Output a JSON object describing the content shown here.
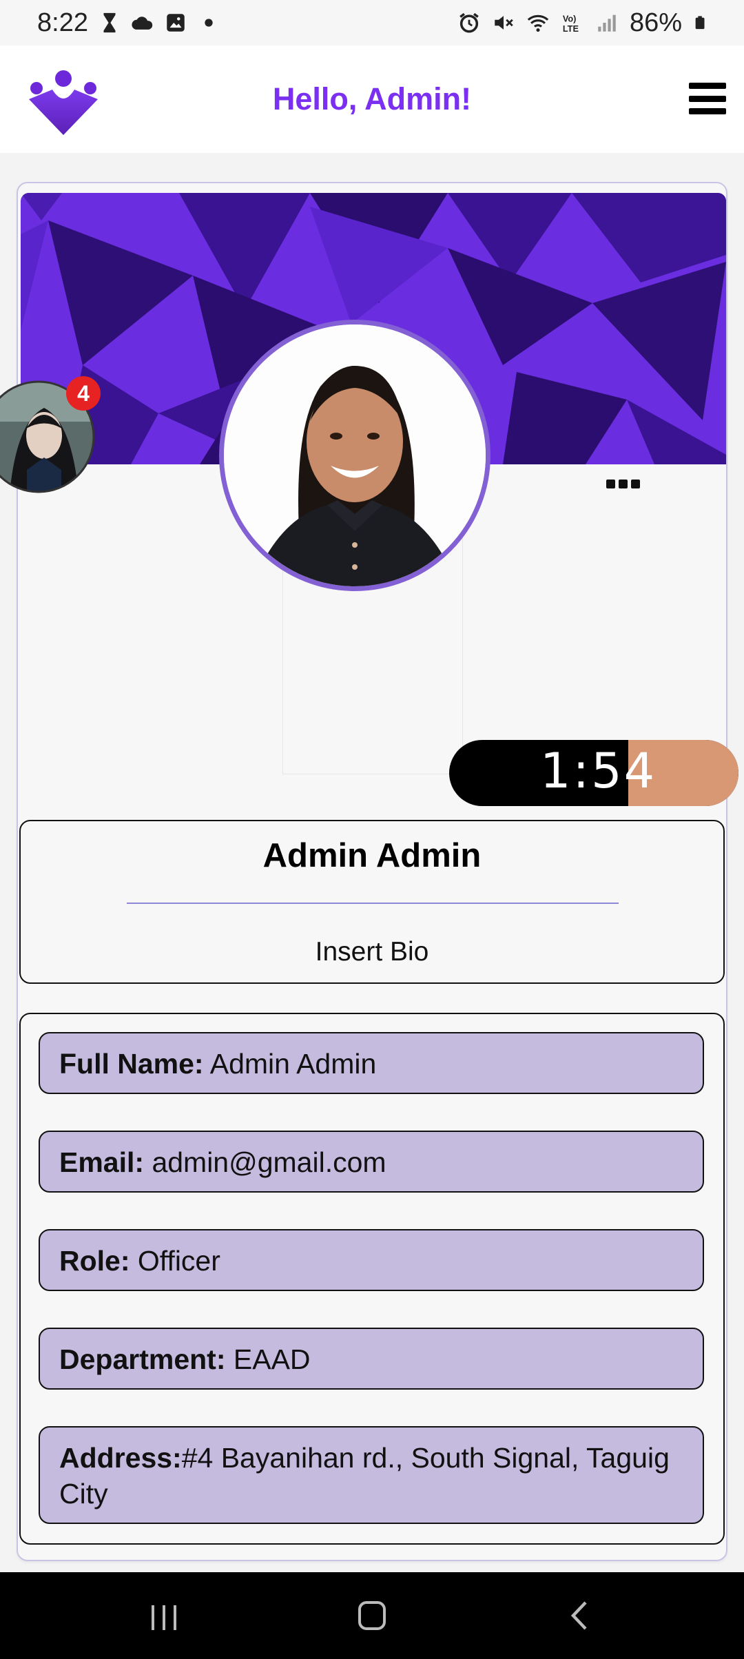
{
  "status_bar": {
    "time": "8:22",
    "battery": "86%",
    "left_icons": [
      "hourglass-icon",
      "cloud-icon",
      "image-icon",
      "dot-icon"
    ],
    "right_icons": [
      "alarm-icon",
      "mute-icon",
      "wifi-icon",
      "volte-icon",
      "signal-icon",
      "battery-icon"
    ]
  },
  "header": {
    "title": "Hello, Admin!",
    "logo_icon": "app-logo-icon",
    "menu_icon": "hamburger-menu-icon",
    "accent_color": "#7b2ff0"
  },
  "profile": {
    "name": "Admin Admin",
    "bio": "Insert Bio",
    "more_icon": "more-options-icon"
  },
  "details": [
    {
      "label": "Full Name:",
      "value": " Admin Admin"
    },
    {
      "label": "Email:",
      "value": " admin@gmail.com"
    },
    {
      "label": "Role:",
      "value": " Officer"
    },
    {
      "label": "Department:",
      "value": " EAAD"
    },
    {
      "label": "Address:",
      "value": "#4 Bayanihan rd., South Signal, Taguig City"
    }
  ],
  "overlay": {
    "chat_badge": "4",
    "timer": "1:54"
  },
  "nav": {
    "icons": [
      "recent-apps-icon",
      "home-icon",
      "back-icon"
    ]
  },
  "colors": {
    "cover_primary": "#6e2fe0",
    "cover_dark": "#2e0f75",
    "detail_bg": "#c5bbdf",
    "avatar_ring": "#8360d4"
  }
}
